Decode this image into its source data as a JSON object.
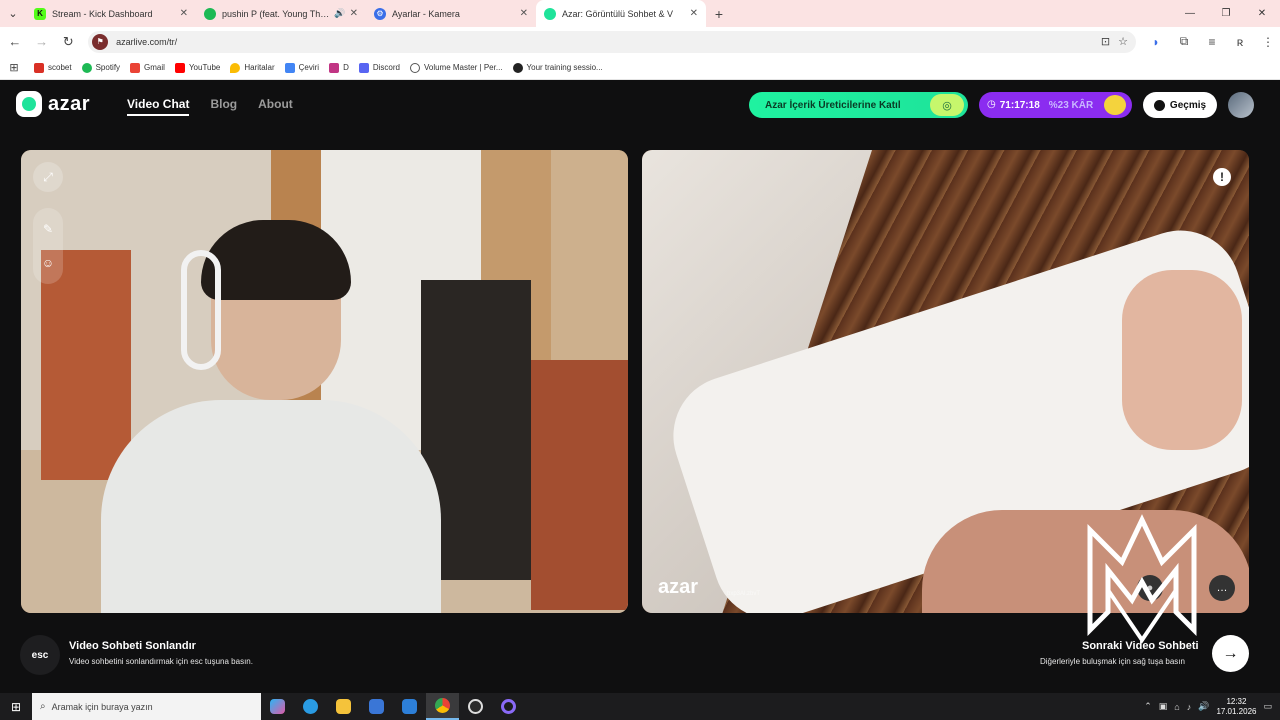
{
  "browser": {
    "tabs": [
      {
        "title": "Stream - Kick Dashboard",
        "favicon_color": "#53fc18",
        "active": false
      },
      {
        "title": "pushin P (feat. Young Thug)",
        "favicon_color": "#1db954",
        "active": false
      },
      {
        "title": "Ayarlar - Kamera",
        "favicon_color": "#3a6ee8",
        "active": false
      },
      {
        "title": "Azar: Görüntülü Sohbet & V",
        "favicon_color": "#1fe39a",
        "active": true
      }
    ],
    "url": "azarlive.com/tr/",
    "bookmarks": [
      {
        "label": "scobet",
        "color": "#d93025"
      },
      {
        "label": "Spotify",
        "color": "#1db954"
      },
      {
        "label": "Gmail",
        "color": "#ea4335"
      },
      {
        "label": "YouTube",
        "color": "#ff0000"
      },
      {
        "label": "Haritalar",
        "color": "#fbbc04"
      },
      {
        "label": "Çeviri",
        "color": "#4285f4"
      },
      {
        "label": "D",
        "color": "#c13584"
      },
      {
        "label": "Discord",
        "color": "#5865f2"
      },
      {
        "label": "Volume Master | Per...",
        "color": "#888888"
      },
      {
        "label": "Your training sessio...",
        "color": "#222222"
      }
    ]
  },
  "site": {
    "logo": "azar",
    "nav": [
      {
        "label": "Video Chat",
        "active": true
      },
      {
        "label": "Blog",
        "active": false
      },
      {
        "label": "About",
        "active": false
      }
    ],
    "promo": "Azar İçerik Üreticilerine Katıl",
    "timer": "71:17:18",
    "discount": "%23 KÂR",
    "history": "Geçmiş",
    "video_logo": "azar",
    "video_id": "bxp3Al.zbvT"
  },
  "footer": {
    "esc_key": "esc",
    "esc_title": "Video Sohbeti Sonlandır",
    "esc_sub": "Video sohbetini sonlandırmak için esc tuşuna basın.",
    "next_title": "Sonraki Video Sohbeti",
    "next_sub": "Diğerleriyle buluşmak için sağ tuşa basın"
  },
  "taskbar": {
    "search_placeholder": "Aramak için buraya yazın",
    "time": "12:32",
    "date": "17.01.2026"
  },
  "colors": {
    "accent_green": "#1fe39a",
    "accent_purple": "#8b2cf0",
    "tab_bar": "#fbe3e3"
  }
}
